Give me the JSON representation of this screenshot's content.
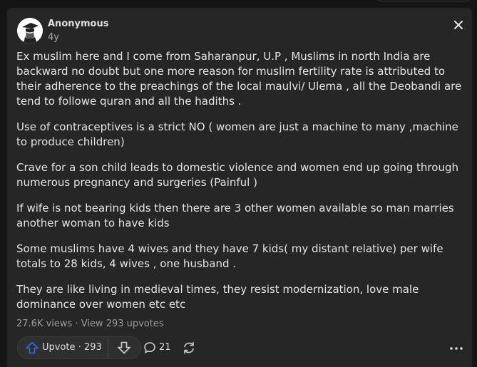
{
  "post": {
    "author": "Anonymous",
    "age": "4y",
    "paragraphs": [
      "Ex muslim here and I come from Saharanpur, U.P , Muslims in north India are backward no doubt but one more reason for muslim fertility rate is attributed to their adherence to the preachings of the local maulvi/ Ulema , all the Deobandi are tend to followe quran and all the hadiths .",
      "Use of contraceptives is a strict NO ( women are just a machine to many ,machine to produce children)",
      "Crave for a son child leads to domestic violence and women end up going through numerous pregnancy and surgeries (Painful )",
      "If wife is not bearing kids then there are 3 other women available so man marries another woman to have kids",
      "Some muslims have 4 wives and they have 7 kids( my distant relative) per wife totals to 28 kids, 4 wives , one husband .",
      "They are like living in medieval times, they resist modernization, love male dominance over women etc etc"
    ]
  },
  "stats": {
    "views": "27.6K views",
    "separator": " · ",
    "upvotes_link": "View 293 upvotes"
  },
  "actions": {
    "upvote_label": "Upvote",
    "upvote_separator": " · ",
    "upvote_count": "293",
    "comment_count": "21"
  },
  "icons": {
    "avatar": "anonymous-avatar-icon",
    "close": "close-icon",
    "upvote": "upvote-arrow-icon",
    "downvote": "downvote-arrow-icon",
    "comment": "comment-bubble-icon",
    "share": "share-icon",
    "more": "more-horizontal-icon"
  },
  "colors": {
    "background": "#151515",
    "card": "#262626",
    "upvote_accent": "#2e69ff",
    "text": "#e4e4e4",
    "muted": "#9c9c9c"
  }
}
